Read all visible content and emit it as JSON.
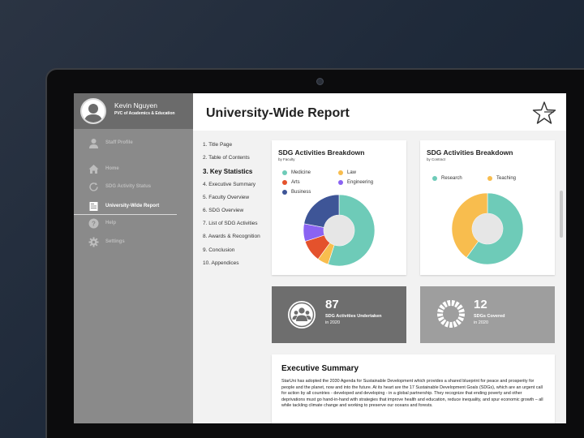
{
  "profile": {
    "name": "Kevin Nguyen",
    "role": "PVC of Academics & Education"
  },
  "sidebar": {
    "items": [
      {
        "label": "Staff Profile",
        "icon": "person-icon"
      },
      {
        "label": "Home",
        "icon": "home-icon"
      },
      {
        "label": "SDG Activity Status",
        "icon": "refresh-icon"
      },
      {
        "label": "University-Wide Report",
        "icon": "report-icon",
        "active": true
      },
      {
        "label": "Help",
        "icon": "help-icon"
      },
      {
        "label": "Settings",
        "icon": "gear-icon"
      }
    ]
  },
  "header": {
    "title": "University-Wide Report"
  },
  "toc": [
    "1. Title Page",
    "2. Table of Contents",
    "3. Key Statistics",
    "4. Executive Summary",
    "5. Faculty Overview",
    "6. SDG Overview",
    "7. List of SDG Activities",
    "8. Awards & Recognition",
    "9. Conclusion",
    "10. Appendices"
  ],
  "colors": {
    "medicine": "#6ecbb8",
    "law": "#f8bd4e",
    "arts": "#e4522c",
    "engineering": "#8a63f2",
    "business": "#3e5597",
    "research": "#6ecbb8",
    "teaching": "#f8bd4e",
    "sidebar": "#8a8a8a",
    "stat_dark": "#6e6e6e",
    "stat_light": "#9e9e9e"
  },
  "chart_data": [
    {
      "type": "pie",
      "title": "SDG Activities Breakdown",
      "subtitle": "by Faculty",
      "categories": [
        "Medicine",
        "Law",
        "Arts",
        "Engineering",
        "Business"
      ],
      "values": [
        55,
        5,
        10,
        8,
        22
      ]
    },
    {
      "type": "pie",
      "title": "SDG Activities Breakdown",
      "subtitle": "by Contract",
      "categories": [
        "Research",
        "Teaching"
      ],
      "values": [
        60,
        40
      ]
    }
  ],
  "stats": [
    {
      "number": "87",
      "line1": "SDG Activities Undertaken",
      "line2": "in 2020",
      "icon": "people-icon"
    },
    {
      "number": "12",
      "line1": "SDGs Covered",
      "line2": "in 2020",
      "icon": "sdg-wheel-icon"
    }
  ],
  "executive_summary": {
    "title": "Executive Summary",
    "text": "StarUni has adopted the 2030 Agenda for Sustainable Development which provides a shared blueprint for peace and prosperity for people and the planet, now and into the future. At its heart are the 17 Sustainable Development Goals (SDGs), which are an urgent call for action by all countries - developed and developing - in a global partnership. They recognize that ending poverty and other deprivations must go hand-in-hand with strategies that improve health and education, reduce inequality, and spur economic growth – all while tackling climate change and working to preserve our oceans and forests."
  }
}
